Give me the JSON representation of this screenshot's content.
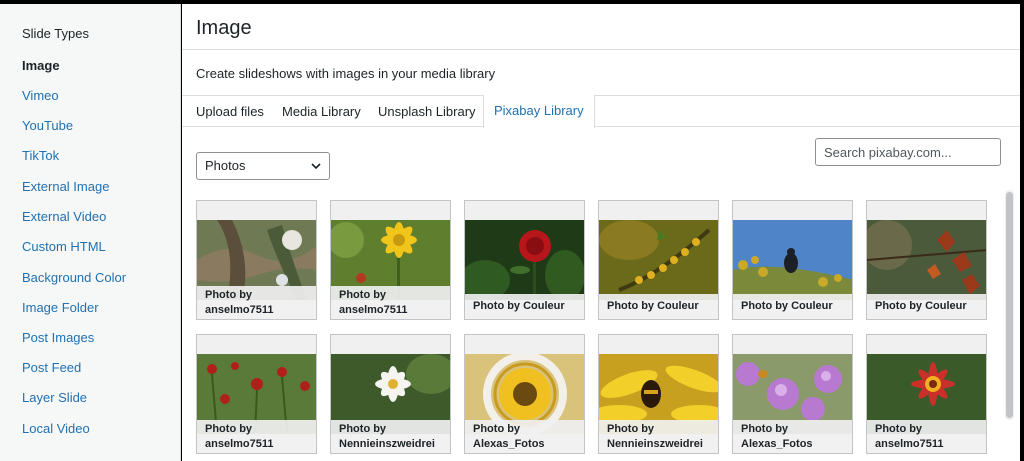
{
  "sidebar": {
    "heading": "Slide Types",
    "items": [
      {
        "label": "Image",
        "active": true
      },
      {
        "label": "Vimeo"
      },
      {
        "label": "YouTube"
      },
      {
        "label": "TikTok"
      },
      {
        "label": "External Image"
      },
      {
        "label": "External Video"
      },
      {
        "label": "Custom HTML"
      },
      {
        "label": "Background Color"
      },
      {
        "label": "Image Folder"
      },
      {
        "label": "Post Images"
      },
      {
        "label": "Post Feed"
      },
      {
        "label": "Layer Slide"
      },
      {
        "label": "Local Video"
      }
    ]
  },
  "main": {
    "title": "Image",
    "description": "Create slideshows with images in your media library",
    "tabs": [
      {
        "label": "Upload files"
      },
      {
        "label": "Media Library"
      },
      {
        "label": "Unsplash Library"
      },
      {
        "label": "Pixabay Library",
        "active": true
      }
    ],
    "filter": {
      "selected": "Photos"
    },
    "search": {
      "placeholder": "Search pixabay.com..."
    },
    "photos": [
      {
        "line1": "Photo by",
        "line2": "anselmo7511",
        "subject": "tree-bark"
      },
      {
        "line1": "Photo by",
        "line2": "anselmo7511",
        "subject": "yellow-flower"
      },
      {
        "line1": "Photo by Couleur",
        "line2": "",
        "subject": "red-rose"
      },
      {
        "line1": "Photo by Couleur",
        "line2": "",
        "subject": "yellow-blossoms"
      },
      {
        "line1": "Photo by Couleur",
        "line2": "",
        "subject": "bird-on-branch"
      },
      {
        "line1": "Photo by Couleur",
        "line2": "",
        "subject": "autumn-leaves"
      },
      {
        "line1": "Photo by",
        "line2": "anselmo7511",
        "subject": "red-flowers"
      },
      {
        "line1": "Photo by",
        "line2": "Nennieinszweidrei",
        "subject": "white-flower"
      },
      {
        "line1": "Photo by",
        "line2": "Alexas_Fotos",
        "subject": "sunflower-rings"
      },
      {
        "line1": "Photo by",
        "line2": "Nennieinszweidrei",
        "subject": "bee-on-flower"
      },
      {
        "line1": "Photo by",
        "line2": "Alexas_Fotos",
        "subject": "purple-flowers"
      },
      {
        "line1": "Photo by",
        "line2": "anselmo7511",
        "subject": "red-gaillardia"
      }
    ]
  }
}
